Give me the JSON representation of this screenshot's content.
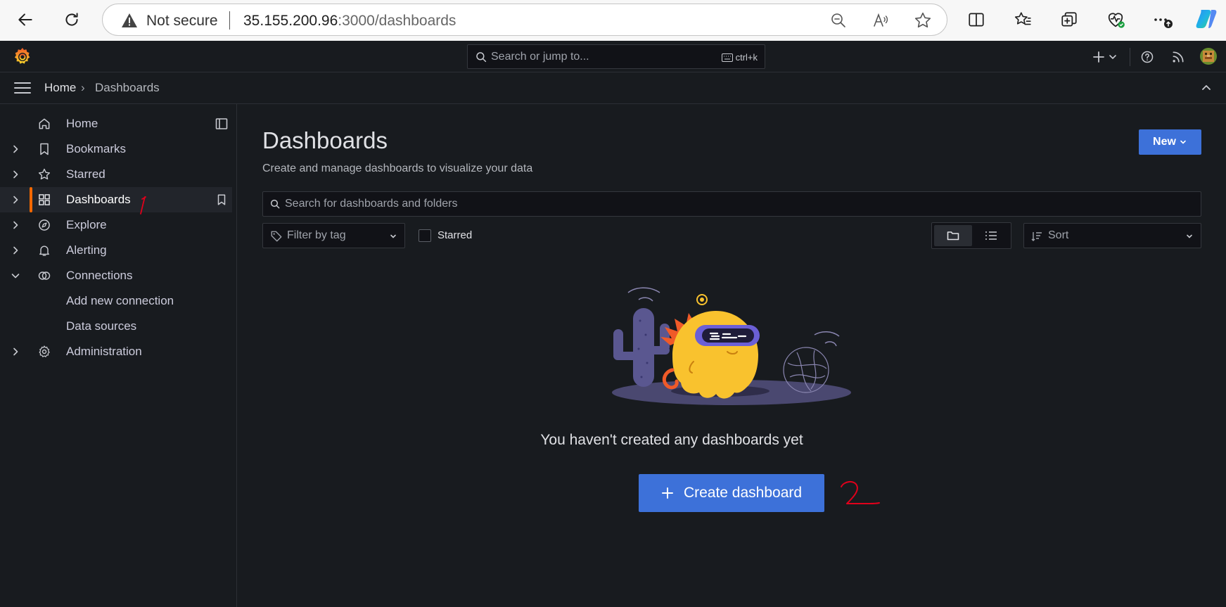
{
  "browser": {
    "security_label": "Not secure",
    "url_host": "35.155.200.96",
    "url_path": ":3000/dashboards"
  },
  "topbar": {
    "search_placeholder": "Search or jump to...",
    "search_shortcut": "ctrl+k"
  },
  "breadcrumb": {
    "home": "Home",
    "separator": "›",
    "current": "Dashboards"
  },
  "sidebar": {
    "items": [
      {
        "label": "Home",
        "icon": "home-icon",
        "expandable": false
      },
      {
        "label": "Bookmarks",
        "icon": "bookmark-icon",
        "expandable": true
      },
      {
        "label": "Starred",
        "icon": "star-icon",
        "expandable": true
      },
      {
        "label": "Dashboards",
        "icon": "apps-icon",
        "expandable": true,
        "active": true
      },
      {
        "label": "Explore",
        "icon": "compass-icon",
        "expandable": true
      },
      {
        "label": "Alerting",
        "icon": "bell-icon",
        "expandable": true
      },
      {
        "label": "Connections",
        "icon": "connections-icon",
        "expandable": true,
        "expanded": true
      },
      {
        "label": "Add new connection",
        "icon": "",
        "sub": true
      },
      {
        "label": "Data sources",
        "icon": "",
        "sub": true
      },
      {
        "label": "Administration",
        "icon": "cog-icon",
        "expandable": true
      }
    ]
  },
  "main": {
    "title": "Dashboards",
    "subtitle": "Create and manage dashboards to visualize your data",
    "new_button": "New",
    "search_placeholder": "Search for dashboards and folders",
    "filter_tag_placeholder": "Filter by tag",
    "starred_label": "Starred",
    "sort_placeholder": "Sort",
    "empty_message": "You haven't created any dashboards yet",
    "create_button": "Create dashboard"
  },
  "colors": {
    "accent_blue": "#3d71d9",
    "active_orange": "#f46800",
    "annotation_red": "#e0001b"
  }
}
